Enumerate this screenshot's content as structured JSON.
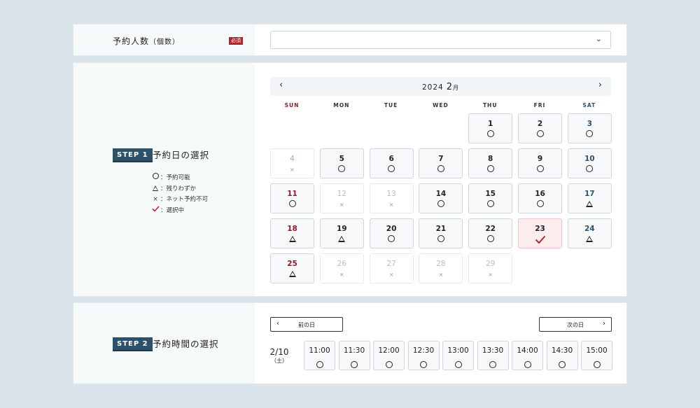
{
  "people": {
    "label": "予約人数",
    "sub": "（個数）",
    "required": "必須",
    "selected": "",
    "chevron": "⌄"
  },
  "step1": {
    "badge": "STEP 1",
    "title": "予約日の選択"
  },
  "legend": [
    {
      "symbol": "circle",
      "text": "：予約可能"
    },
    {
      "symbol": "triangle",
      "text": "：残りわずか"
    },
    {
      "symbol": "cross",
      "text": "：ネット予約不可"
    },
    {
      "symbol": "check",
      "text": "：選択中"
    }
  ],
  "calendar": {
    "year": "2024",
    "month": "2",
    "month_unit": "月",
    "prev": "‹",
    "next": "›",
    "weekdays": [
      "SUN",
      "MON",
      "TUE",
      "WED",
      "THU",
      "FRI",
      "SAT"
    ],
    "first_weekday_index": 4,
    "days": [
      {
        "day": "1",
        "status": "circle"
      },
      {
        "day": "2",
        "status": "circle"
      },
      {
        "day": "3",
        "status": "circle"
      },
      {
        "day": "4",
        "status": "cross"
      },
      {
        "day": "5",
        "status": "circle"
      },
      {
        "day": "6",
        "status": "circle"
      },
      {
        "day": "7",
        "status": "circle"
      },
      {
        "day": "8",
        "status": "circle"
      },
      {
        "day": "9",
        "status": "circle"
      },
      {
        "day": "10",
        "status": "circle"
      },
      {
        "day": "11",
        "status": "circle"
      },
      {
        "day": "12",
        "status": "cross"
      },
      {
        "day": "13",
        "status": "cross"
      },
      {
        "day": "14",
        "status": "circle"
      },
      {
        "day": "15",
        "status": "circle"
      },
      {
        "day": "16",
        "status": "circle"
      },
      {
        "day": "17",
        "status": "triangle"
      },
      {
        "day": "18",
        "status": "triangle"
      },
      {
        "day": "19",
        "status": "triangle"
      },
      {
        "day": "20",
        "status": "circle"
      },
      {
        "day": "21",
        "status": "circle"
      },
      {
        "day": "22",
        "status": "circle"
      },
      {
        "day": "23",
        "status": "selected"
      },
      {
        "day": "24",
        "status": "triangle"
      },
      {
        "day": "25",
        "status": "triangle"
      },
      {
        "day": "26",
        "status": "cross"
      },
      {
        "day": "27",
        "status": "cross"
      },
      {
        "day": "28",
        "status": "cross"
      },
      {
        "day": "29",
        "status": "cross"
      }
    ]
  },
  "step2": {
    "badge": "STEP 2",
    "title": "予約時間の選択"
  },
  "timenav": {
    "prev_label": "前の日",
    "next_label": "次の日",
    "prev_arrow": "‹",
    "next_arrow": "›"
  },
  "slots_date": {
    "date": "2/10",
    "weekday": "（土）"
  },
  "slots": [
    {
      "time": "11:00",
      "status": "circle"
    },
    {
      "time": "11:30",
      "status": "circle"
    },
    {
      "time": "12:00",
      "status": "circle"
    },
    {
      "time": "12:30",
      "status": "circle"
    },
    {
      "time": "13:00",
      "status": "circle"
    },
    {
      "time": "13:30",
      "status": "circle"
    },
    {
      "time": "14:00",
      "status": "circle"
    },
    {
      "time": "14:30",
      "status": "circle"
    },
    {
      "time": "15:00",
      "status": "circle"
    }
  ],
  "colors": {
    "accent": "#2d5169",
    "required": "#b5252f",
    "sunday": "#8c1c27",
    "selected_bg": "#fbecee",
    "check": "#b5252f"
  }
}
